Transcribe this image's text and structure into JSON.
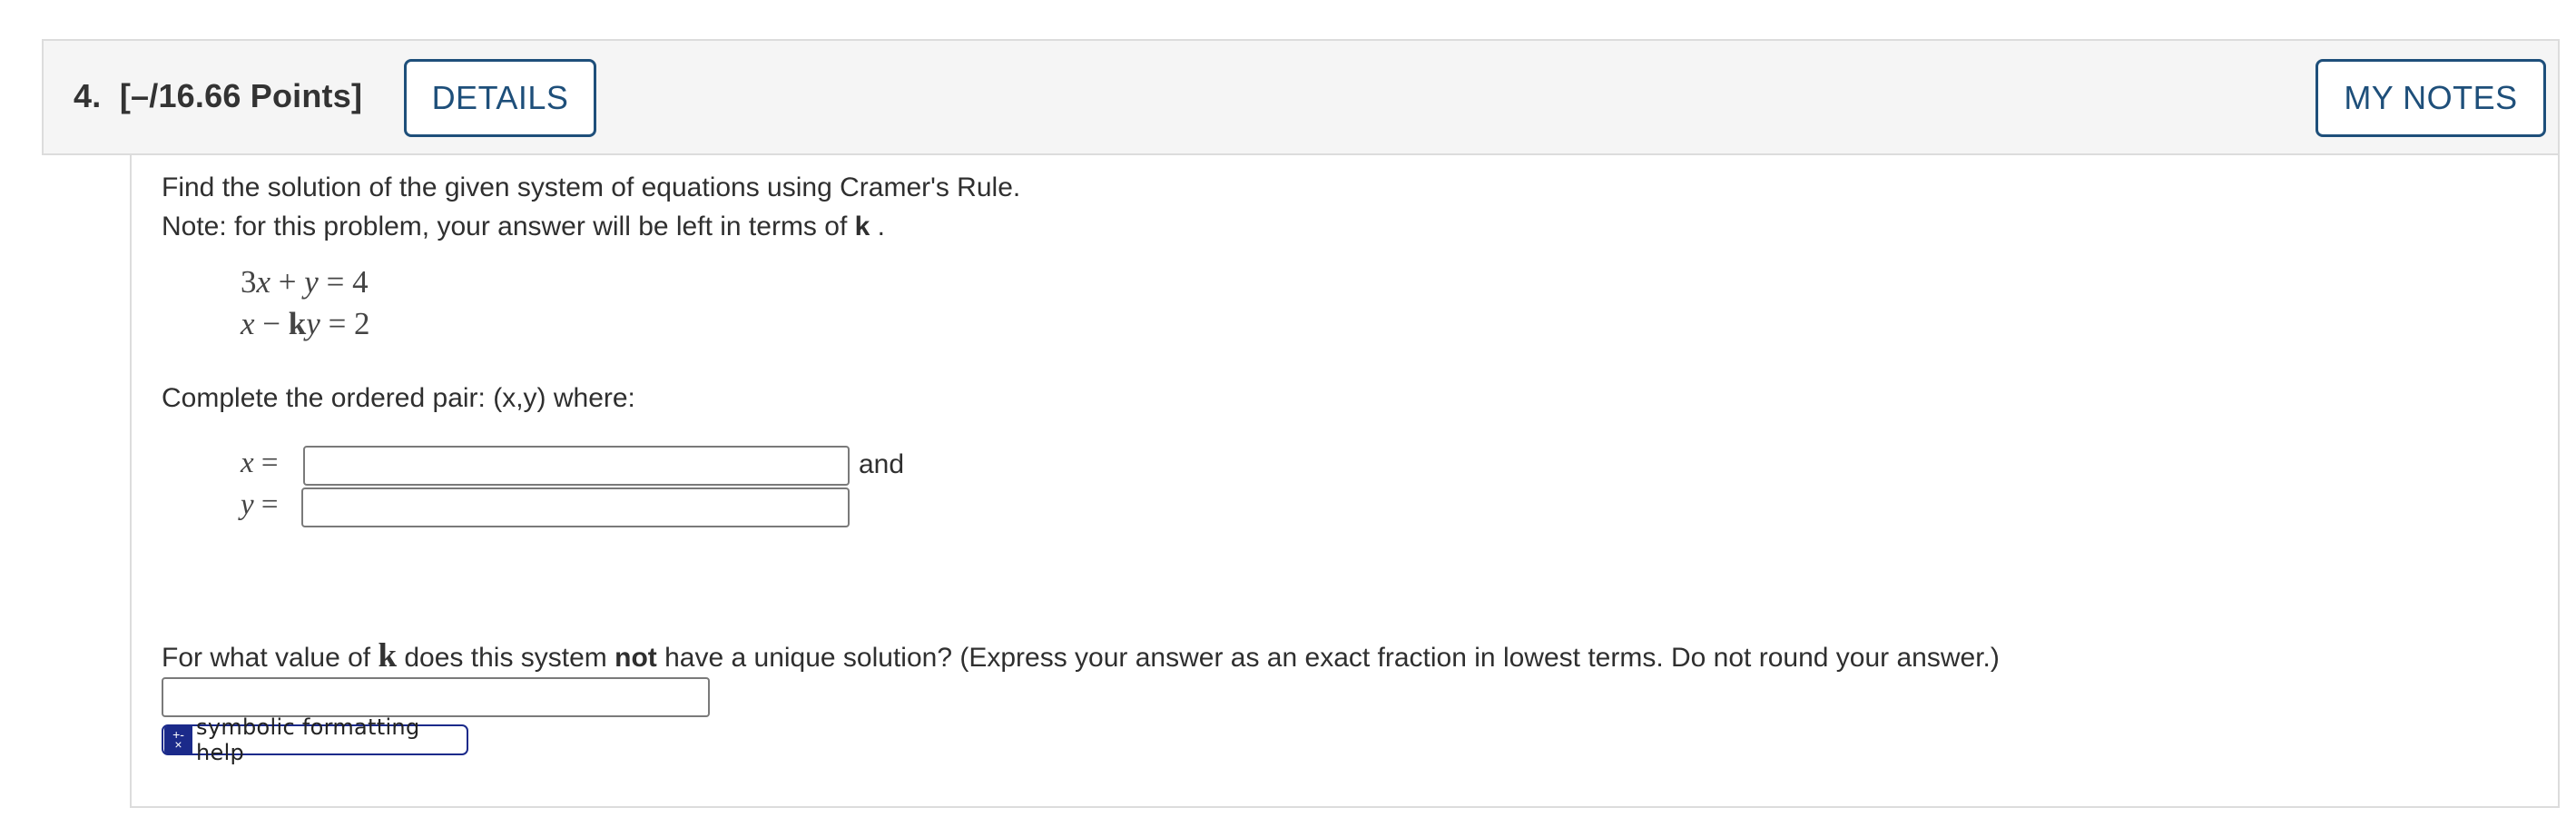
{
  "question": {
    "number": "4.",
    "points": "[–/16.66 Points]",
    "details_label": "DETAILS",
    "notes_label": "MY NOTES"
  },
  "problem": {
    "line1": "Find the solution of the given system of equations using Cramer's Rule.",
    "line2_prefix": "Note: for this problem, your answer will be left in terms of ",
    "line2_var": "k",
    "line2_suffix": " .",
    "eq1": {
      "a": "3",
      "x": "x",
      "plus": " + ",
      "y": "y",
      "rhs": " = 4"
    },
    "eq2": {
      "x": "x",
      "minus": " − ",
      "k": "k",
      "y": "y",
      "rhs": " = 2"
    },
    "pair_prompt": "Complete the ordered pair: (x,y) where:",
    "x_label": "x",
    "y_label": "y",
    "equals": " =",
    "and_text": "and",
    "x_value": "",
    "y_value": ""
  },
  "part2": {
    "prefix": "For what value of ",
    "var": "k",
    "middle": " does this system ",
    "bold": "not",
    "suffix": " have a unique solution? (Express your answer as an exact fraction in lowest terms. Do not round your answer.)",
    "value": ""
  },
  "help": {
    "icon_top": "+-",
    "icon_bottom": "×",
    "label": "symbolic formatting help"
  }
}
